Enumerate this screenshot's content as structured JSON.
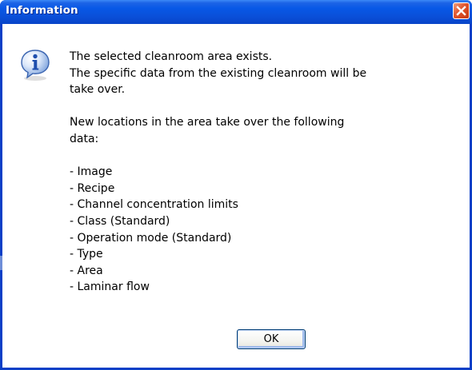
{
  "window": {
    "title": "Information",
    "close_icon": "close-icon"
  },
  "message": {
    "lines": [
      "The selected cleanroom area exists.",
      "The specific data from the existing cleanroom will be",
      "take over.",
      "",
      "New locations in the area take over the following",
      "data:",
      "",
      "- Image",
      "- Recipe",
      "- Channel concentration limits",
      "- Class (Standard)",
      "- Operation mode (Standard)",
      "- Type",
      "- Area",
      "- Laminar flow"
    ]
  },
  "buttons": {
    "ok_label": "OK"
  },
  "icons": {
    "message_icon": "information-icon"
  },
  "colors": {
    "titlebar": "#0a4fd8",
    "close_button": "#e0542c",
    "client_background": "#ffffff"
  }
}
